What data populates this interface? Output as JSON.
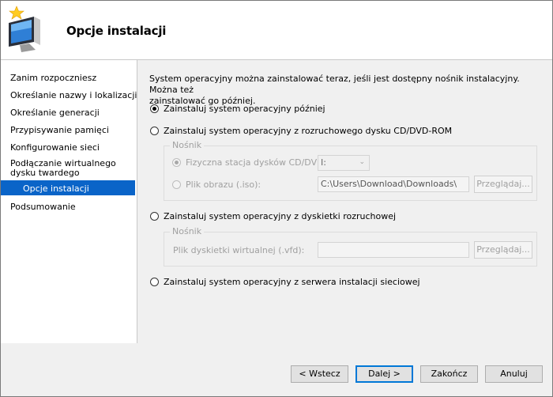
{
  "header": {
    "title": "Opcje instalacji",
    "logo_icon": "monitor-with-star-icon"
  },
  "sidebar": {
    "items": [
      {
        "label": "Zanim rozpoczniesz"
      },
      {
        "label": "Określanie nazwy i lokalizacji"
      },
      {
        "label": "Określanie generacji"
      },
      {
        "label": "Przypisywanie pamięci"
      },
      {
        "label": "Konfigurowanie sieci"
      },
      {
        "label": "Podłączanie wirtualnego",
        "label2": "dysku twardego"
      },
      {
        "label": "Opcje instalacji",
        "active": true
      },
      {
        "label": "Podsumowanie"
      }
    ]
  },
  "main": {
    "intro_line1": "System operacyjny można zainstalować teraz, jeśli jest dostępny nośnik instalacyjny. Można też",
    "intro_line2": "zainstalować go później.",
    "options": {
      "later": "Zainstaluj system operacyjny później",
      "cd": "Zainstaluj system operacyjny z rozruchowego dysku CD/DVD-ROM",
      "floppy": "Zainstaluj system operacyjny z dyskietki rozruchowej",
      "network": "Zainstaluj system operacyjny z serwera instalacji sieciowej"
    },
    "cd_group": {
      "legend": "Nośnik",
      "physical_label": "Fizyczna stacja dysków CD/DVD:",
      "physical_value": "I:",
      "image_label": "Plik obrazu (.iso):",
      "image_value": "C:\\Users\\Download\\Downloads\\",
      "browse_label": "Przeglądaj..."
    },
    "floppy_group": {
      "legend": "Nośnik",
      "vfd_label": "Plik dyskietki wirtualnej (.vfd):",
      "vfd_value": "",
      "browse_label": "Przeglądaj..."
    }
  },
  "footer": {
    "back_label": "< Wstecz",
    "next_label": "Dalej >",
    "finish_label": "Zakończ",
    "cancel_label": "Anuluj"
  }
}
